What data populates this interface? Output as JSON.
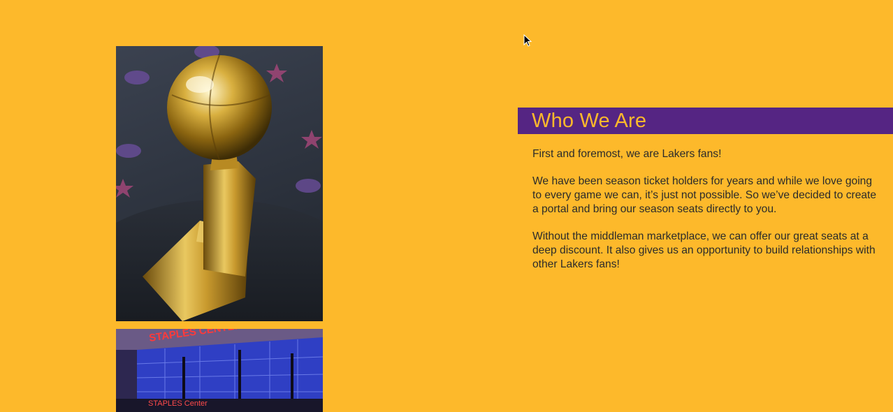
{
  "colors": {
    "background": "#FDB92B",
    "heading_bar": "#552583",
    "heading_text": "#FDB92B",
    "body_text": "#2b2b2b"
  },
  "images": {
    "trophy": "Larry O'Brien championship trophy photo",
    "arena": "Staples Center arena photo"
  },
  "arena_signs": {
    "top": "STAPLES CENTER",
    "bottom": "STAPLES Center"
  },
  "about": {
    "heading": "Who We Are",
    "paragraphs": [
      "First and foremost, we are Lakers fans!",
      "We have been season ticket holders for years and while we love going to every game we can, it’s just not possible. So we’ve decided to create a portal and bring our season seats directly to you.",
      "Without the middleman marketplace, we can offer our great seats at a deep discount. It also gives us an opportunity to build relationships with other Lakers fans!"
    ]
  }
}
